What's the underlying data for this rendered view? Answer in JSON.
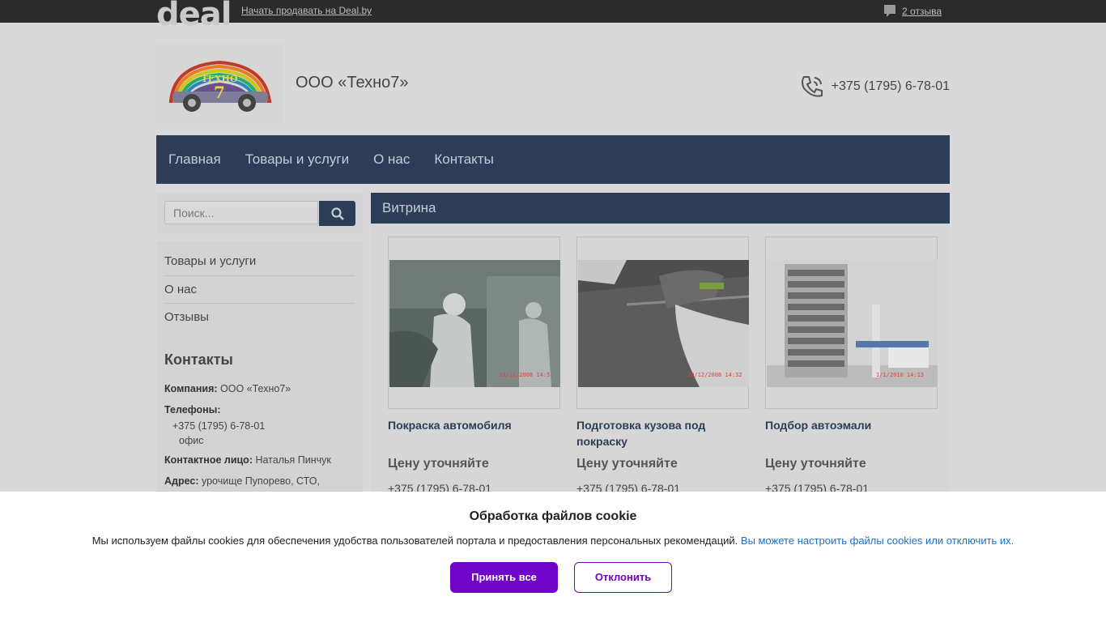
{
  "topbar": {
    "logo": "deal",
    "sell_link": "Начать продавать на Deal.by",
    "reviews": "2 отзыва",
    "reviews_icon": "speech-bubble-icon"
  },
  "header": {
    "company_name": "ООО «Техно7»",
    "phone": "+375 (1795) 6-78-01",
    "phone_icon": "phone-icon",
    "logo_text": "ТЕХНО",
    "logo_number": "7"
  },
  "nav": {
    "items": [
      "Главная",
      "Товары и услуги",
      "О нас",
      "Контакты"
    ]
  },
  "search": {
    "placeholder": "Поиск...",
    "icon": "search-icon"
  },
  "sidebar": {
    "menu": [
      "Товары и услуги",
      "О нас",
      "Отзывы"
    ],
    "contacts_title": "Контакты",
    "company_label": "Компания:",
    "company_value": "ООО «Техно7»",
    "phones_label": "Телефоны:",
    "phone_value": "+375 (1795) 6-78-01",
    "phone_note": "офис",
    "person_label": "Контактное лицо:",
    "person_value": "Наталья Пинчук",
    "address_label": "Адрес:",
    "address_value": "урочище Пупорево, СТО,"
  },
  "main": {
    "heading": "Витрина",
    "cards": [
      {
        "title": "Покраска автомобиля",
        "price": "Цену уточняйте",
        "phone": "+375 (1795) 6-78-01",
        "stamp": "19/12/2008 14:5"
      },
      {
        "title": "Подготовка кузова под покраску",
        "price": "Цену уточняйте",
        "phone": "+375 (1795) 6-78-01",
        "stamp": "19/12/2008 14:32"
      },
      {
        "title": "Подбор автоэмали",
        "price": "Цену уточняйте",
        "phone": "+375 (1795) 6-78-01",
        "stamp": "1/1/2010 14:13"
      }
    ]
  },
  "cookie": {
    "title": "Обработка файлов cookie",
    "text": "Мы используем файлы cookies для обеспечения удобства пользователей портала и предоставления персональных рекомендаций.",
    "link": "Вы можете настроить файлы cookies или отключить их.",
    "accept": "Принять все",
    "decline": "Отклонить"
  },
  "colors": {
    "nav_bg": "#2d3d57",
    "accent": "#6f05c9",
    "link": "#1a6fd1"
  }
}
